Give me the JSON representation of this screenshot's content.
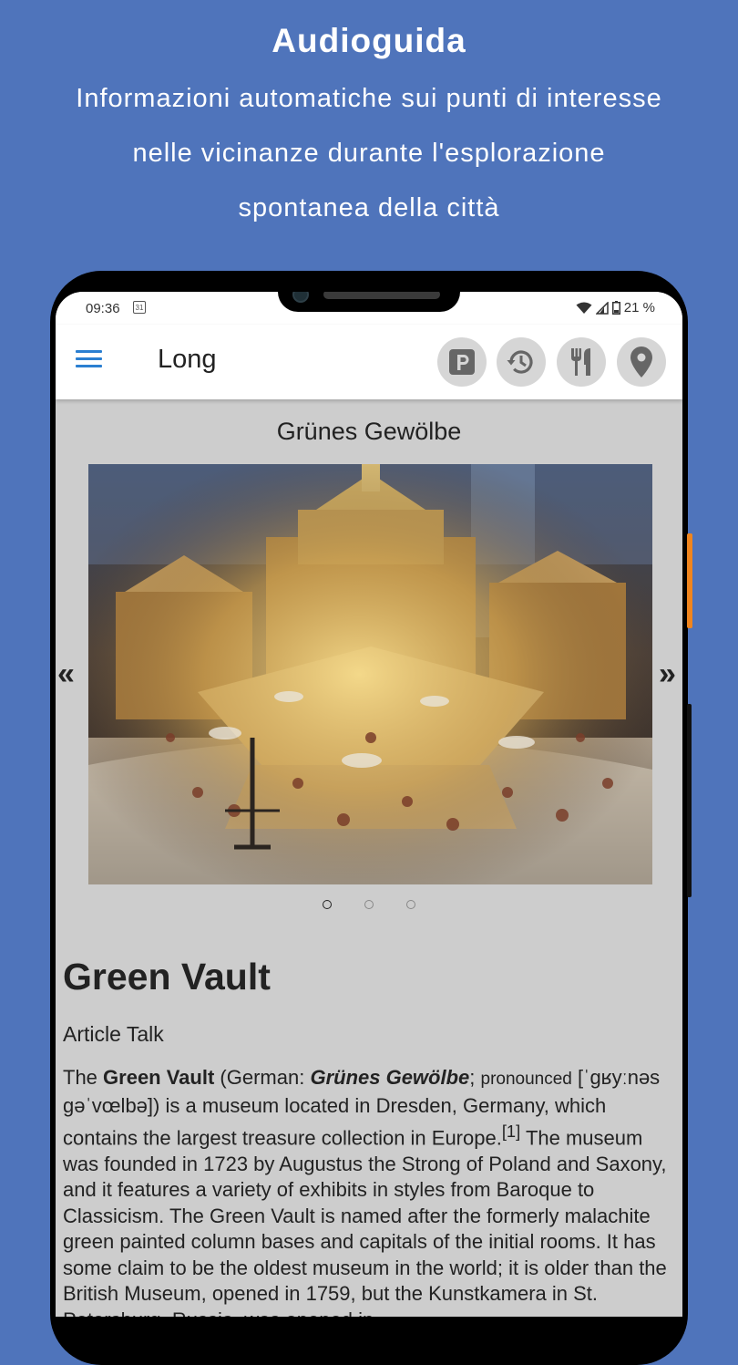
{
  "promo": {
    "title": "Audioguida",
    "line1": "Informazioni automatiche sui punti di interesse",
    "line2": "nelle vicinanze durante l'esplorazione",
    "line3": "spontanea della città"
  },
  "status_bar": {
    "time": "09:36",
    "calendar_day": "31",
    "battery": "21 %",
    "icons": [
      "calendar-icon",
      "wifi-icon",
      "signal-icon",
      "battery-icon"
    ]
  },
  "app_bar": {
    "title": "Long",
    "buttons": [
      "parking-icon",
      "history-icon",
      "restaurant-icon",
      "location-pin-icon"
    ],
    "accent_color": "#2b7fd1"
  },
  "gallery": {
    "place_name": "Grünes Gewölbe",
    "prev": "«",
    "next": "»",
    "page_count": 3,
    "current_page": 1
  },
  "article": {
    "title": "Green Vault",
    "tabs": "Article Talk",
    "p_the": "The ",
    "p_name": "Green Vault",
    "p_german_prefix": " (German: ",
    "p_german_name": "Grünes Gewölbe",
    "p_semicolon": "; ",
    "p_pronounced": "pronounced",
    "p_ipa": " [ˈɡʁyːnəs ɡəˈvœlbə]",
    "p_after_ipa": ") is a museum located in Dresden, Germany, which contains the largest treasure collection in Europe.",
    "p_ref": "[1]",
    "p_rest": " The museum was founded in 1723 by Augustus the Strong of Poland and Saxony, and it features a variety of exhibits in styles from Baroque to Classicism. The Green Vault is named after the formerly malachite green painted column bases and capitals of the initial rooms. It has some claim to be the oldest museum in the world; it is older than the British Museum, opened in 1759, but the Kunstkamera in St. Petersburg, Russia, was opened in"
  }
}
